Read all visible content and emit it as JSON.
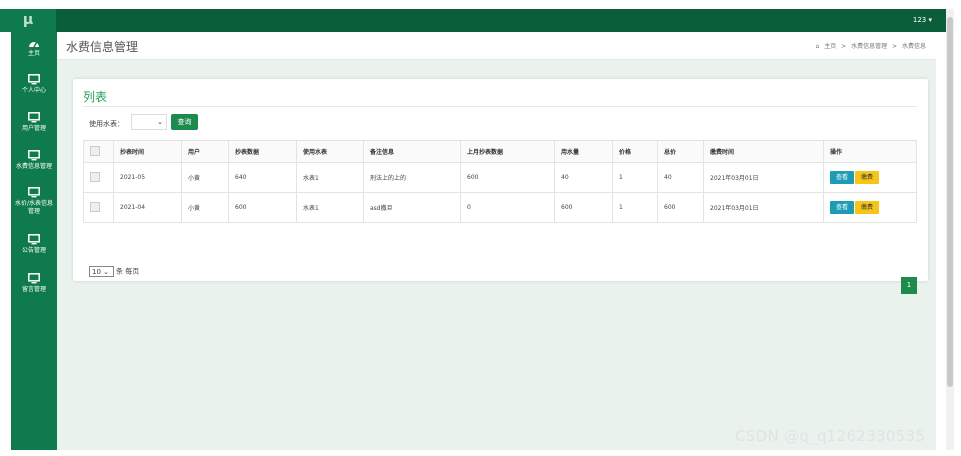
{
  "app": {
    "logo": "μ",
    "user_menu": "123 ▾"
  },
  "sidebar": {
    "items": [
      {
        "label": "主页",
        "icon": "dashboard-icon"
      },
      {
        "label": "个人中心",
        "icon": "monitor-icon"
      },
      {
        "label": "用户管理",
        "icon": "monitor-icon"
      },
      {
        "label": "水费信息管理",
        "icon": "monitor-icon"
      },
      {
        "label_line1": "水价/水表信息",
        "label_line2": "管理",
        "icon": "monitor-icon"
      },
      {
        "label": "公告管理",
        "icon": "monitor-icon"
      },
      {
        "label": "留言管理",
        "icon": "monitor-icon"
      }
    ]
  },
  "header": {
    "title": "水费信息管理",
    "breadcrumb": [
      "主页",
      ">",
      "水费信息管理",
      ">",
      "水费信息"
    ]
  },
  "card": {
    "title": "列表",
    "filter_label": "使用水表：",
    "filter_value": "",
    "query_label": "查询"
  },
  "table": {
    "columns": [
      "抄表时间",
      "用户",
      "抄表数据",
      "使用水表",
      "备注信息",
      "上月抄表数据",
      "用水量",
      "价格",
      "总价",
      "缴费时间",
      "操作"
    ],
    "rows": [
      {
        "time": "2021-05",
        "user": "小黄",
        "reading": "640",
        "meter": "水表1",
        "remark": "刑法上的上的",
        "last": "600",
        "usage": "40",
        "price": "1",
        "total": "40",
        "paid": "2021年03月01日"
      },
      {
        "time": "2021-04",
        "user": "小黄",
        "reading": "600",
        "meter": "水表1",
        "remark": "asd撒旦",
        "last": "0",
        "usage": "600",
        "price": "1",
        "total": "600",
        "paid": "2021年03月01日"
      }
    ],
    "view_label": "查看",
    "pay_label": "缴费"
  },
  "pagination": {
    "page_size": "10",
    "page_size_suffix": "条 每页",
    "current": "1"
  },
  "watermark": "CSDN @q_q1262330535",
  "colors": {
    "sidebar": "#0f7a4c",
    "topbar": "#0b5e3a",
    "accent": "#1d8a4e",
    "view": "#1e9cb5",
    "pay": "#f5c518"
  }
}
